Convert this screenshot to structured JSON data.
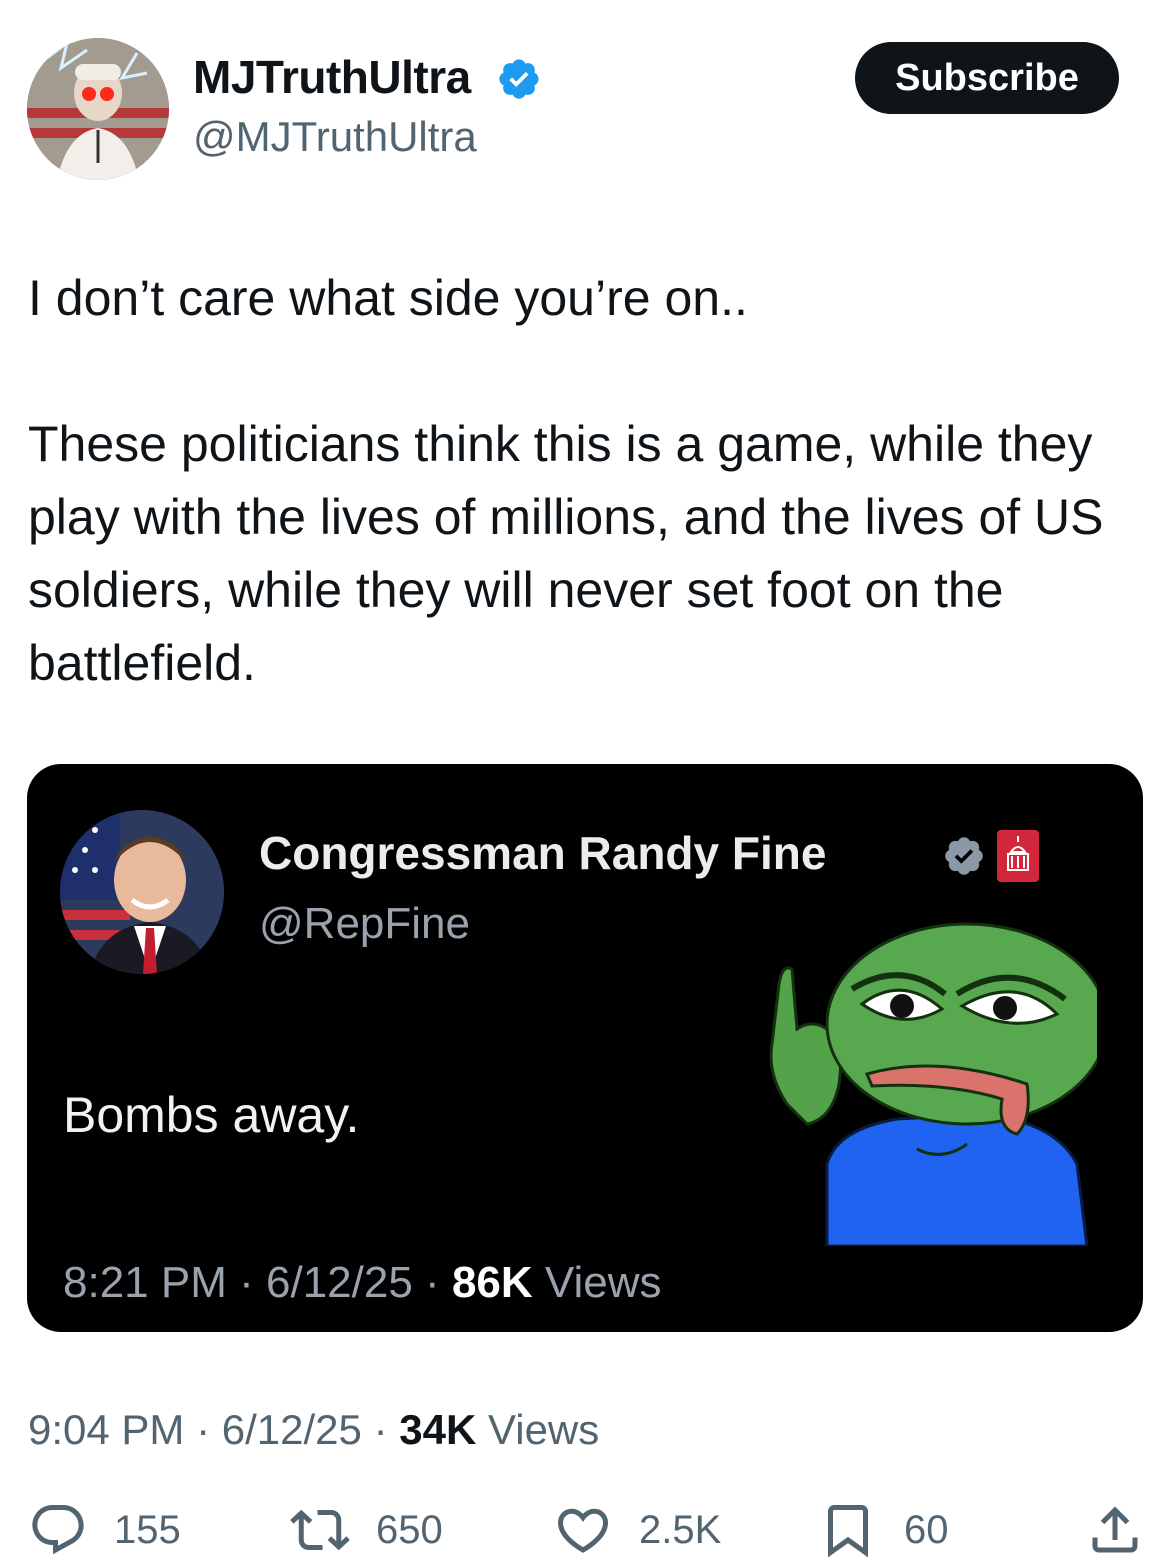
{
  "author": {
    "display_name": "MJTruthUltra",
    "handle": "@MJTruthUltra",
    "verified_icon": "verified-badge-icon",
    "accent": "#1d9bf0"
  },
  "subscribe_label": "Subscribe",
  "tweet": {
    "line1": "I don’t care what side you’re on..",
    "paragraph2": "These politicians think this is a game, while they play with the lives of millions, and the lives of US soldiers, while they will never set foot on the battlefield."
  },
  "quoted": {
    "display_name": "Congressman Randy Fine",
    "handle": "@RepFine",
    "text": "Bombs away.",
    "time": "8:21 PM",
    "date": "6/12/25",
    "views_count": "86K",
    "views_label": "Views",
    "sep": "·"
  },
  "meta": {
    "time": "9:04 PM",
    "date": "6/12/25",
    "views_count": "34K",
    "views_label": "Views",
    "sep": "·"
  },
  "actions": {
    "replies": "155",
    "reposts": "650",
    "likes": "2.5K",
    "bookmarks": "60"
  }
}
